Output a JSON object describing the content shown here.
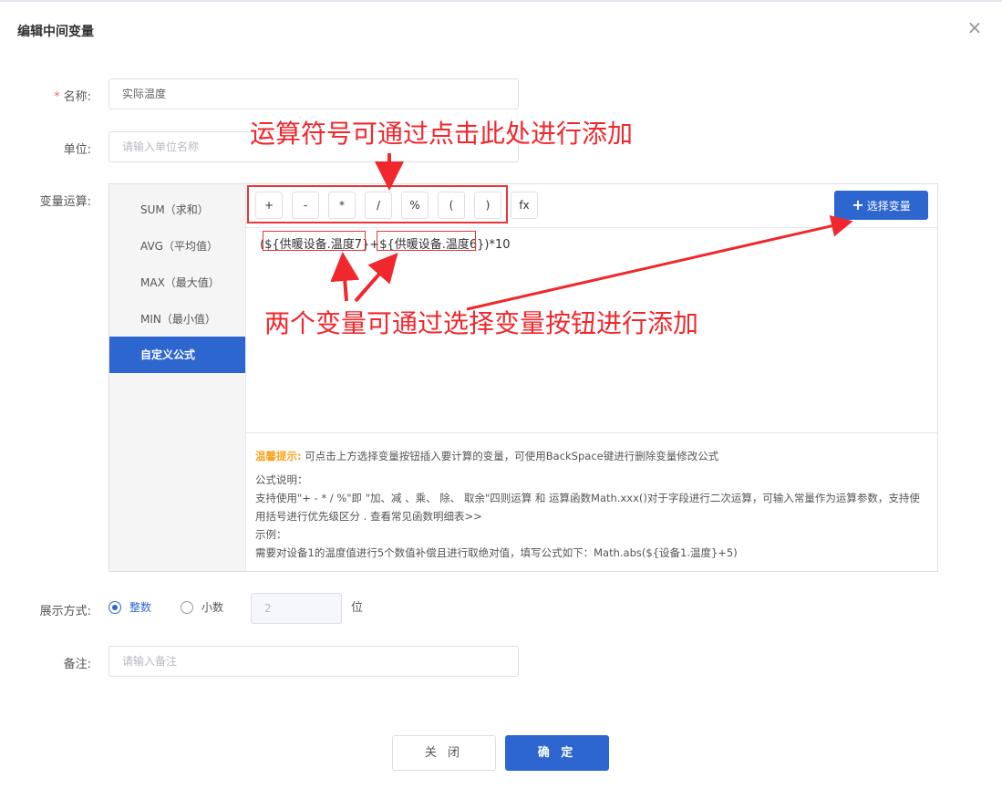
{
  "dialog": {
    "title": "编辑中间变量",
    "close_symbol": "×"
  },
  "form": {
    "name_label": "名称:",
    "name_required": "*",
    "name_value": "实际温度",
    "unit_label": "单位:",
    "unit_placeholder": "请输入单位名称",
    "formula_label": "变量运算:",
    "display_label": "展示方式:",
    "remark_label": "备注:",
    "remark_placeholder": "请输入备注",
    "decimal_value": "2",
    "decimal_unit": "位"
  },
  "sidebar": {
    "items": [
      {
        "label": "SUM（求和）"
      },
      {
        "label": "AVG（平均值）"
      },
      {
        "label": "MAX（最大值）"
      },
      {
        "label": "MIN（最小值）"
      },
      {
        "label": "自定义公式"
      }
    ],
    "active_index": 4
  },
  "operators": [
    "+",
    "-",
    "*",
    "/",
    "%",
    "(",
    ")",
    "fx"
  ],
  "select_variable_button": {
    "icon": "+",
    "label": "选择变量"
  },
  "formula": {
    "open": "(",
    "var1": "${供暖设备.温度7}",
    "plus": "+",
    "var2": "${供暖设备.温度6}",
    "close": ")*10"
  },
  "tips": {
    "hint_title": "温馨提示:",
    "hint_text": "可点击上方选择变量按钮插入要计算的变量，可使用BackSpace键进行删除变量修改公式",
    "desc_title": "公式说明：",
    "desc_text": "支持使用\"+ - * / %\"即 \"加、减 、乘、 除、 取余\"四则运算 和 运算函数Math.xxx()对于字段进行二次运算，可输入常量作为运算参数，支持使用括号进行优先级区分 . 查看常见函数明细表>>",
    "example_title": "示例：",
    "example_text": "需要对设备1的温度值进行5个数值补偿且进行取绝对值，填写公式如下：Math.abs(${设备1.温度}+5)"
  },
  "display_mode": {
    "options": [
      {
        "label": "整数",
        "selected": true
      },
      {
        "label": "小数",
        "selected": false
      }
    ]
  },
  "buttons": {
    "cancel": "关 闭",
    "confirm": "确 定"
  },
  "annotations": {
    "ops_note": "运算符号可通过点击此处进行添加",
    "vars_note": "两个变量可通过选择变量按钮进行添加"
  },
  "colors": {
    "primary": "#2e66d0",
    "annotation_red": "#f0282d",
    "hint_orange": "#f5a623"
  }
}
